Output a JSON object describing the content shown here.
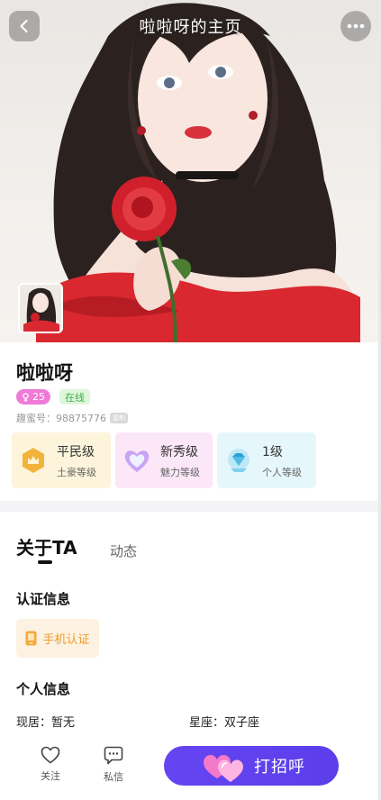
{
  "header": {
    "title": "啦啦呀的主页"
  },
  "profile": {
    "name": "啦啦呀",
    "age": "25",
    "online": "在线",
    "id_text": "趣蜜号：98875776",
    "copy_label": "复制"
  },
  "levels": [
    {
      "title": "平民级",
      "subtitle": "土豪等级",
      "icon": "crown-icon",
      "bg": "#fdf4dc"
    },
    {
      "title": "新秀级",
      "subtitle": "魅力等级",
      "icon": "heart-gem-icon",
      "bg": "#fbe7f8"
    },
    {
      "title": "1级",
      "subtitle": "个人等级",
      "icon": "diamond-badge-icon",
      "bg": "#e6f7fc"
    }
  ],
  "tabs": {
    "about": "关于TA",
    "dynamic": "动态"
  },
  "certification": {
    "title": "认证信息",
    "phone_label": "手机认证"
  },
  "personal": {
    "title": "个人信息",
    "residence": "现居：暂无",
    "zodiac": "星座：双子座"
  },
  "bottom_bar": {
    "follow_label": "关注",
    "message_label": "私信",
    "greet_label": "打招呼"
  },
  "colors": {
    "accent": "#5b3eea",
    "age_badge": "#f07bd6",
    "online": "#3bb04a",
    "cert": "#ee9d2a"
  }
}
